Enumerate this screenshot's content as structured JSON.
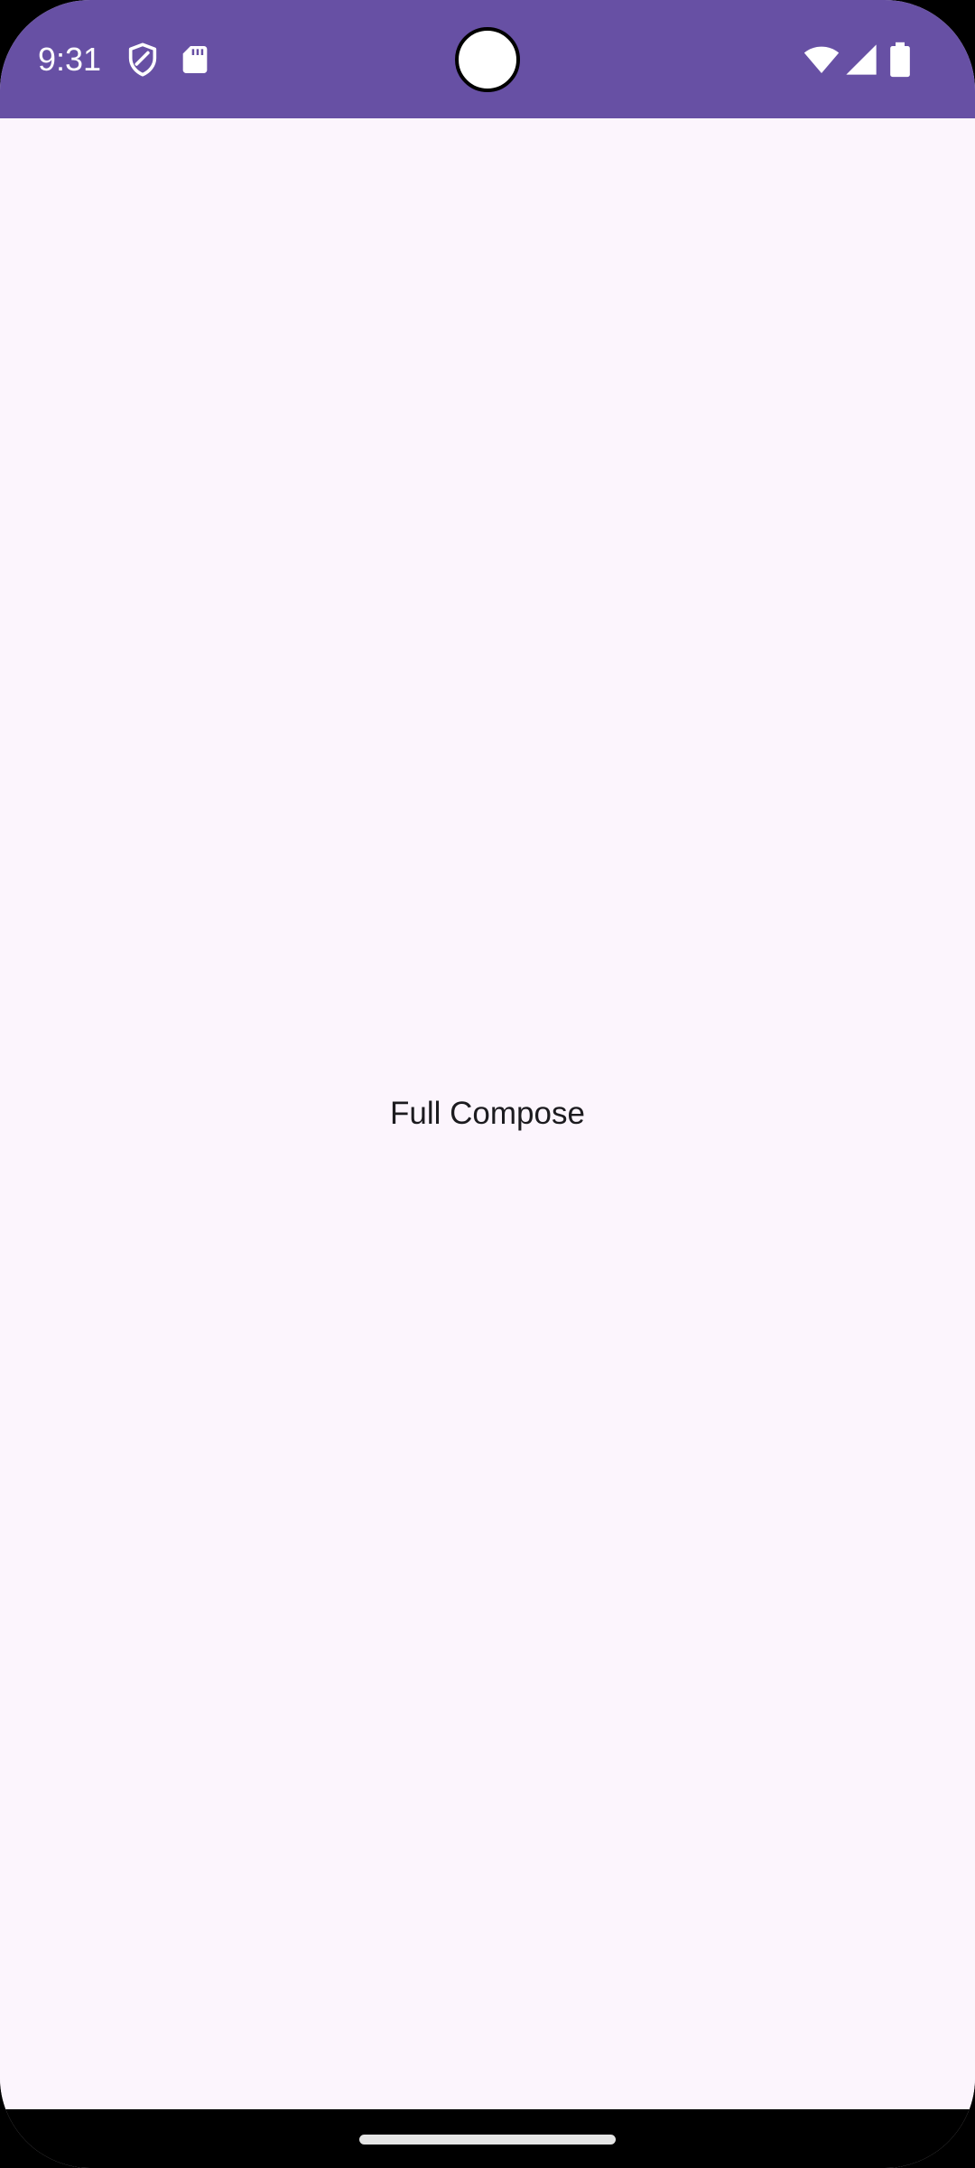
{
  "status_bar": {
    "time": "9:31",
    "color": "#6750A4",
    "icons": [
      "shield-icon",
      "sd-card-icon",
      "wifi-icon",
      "cell-signal-icon",
      "battery-icon"
    ]
  },
  "main": {
    "text": "Full Compose",
    "background": "#FCF5FD"
  },
  "nav_bar": {
    "gesture": "home-handle"
  }
}
